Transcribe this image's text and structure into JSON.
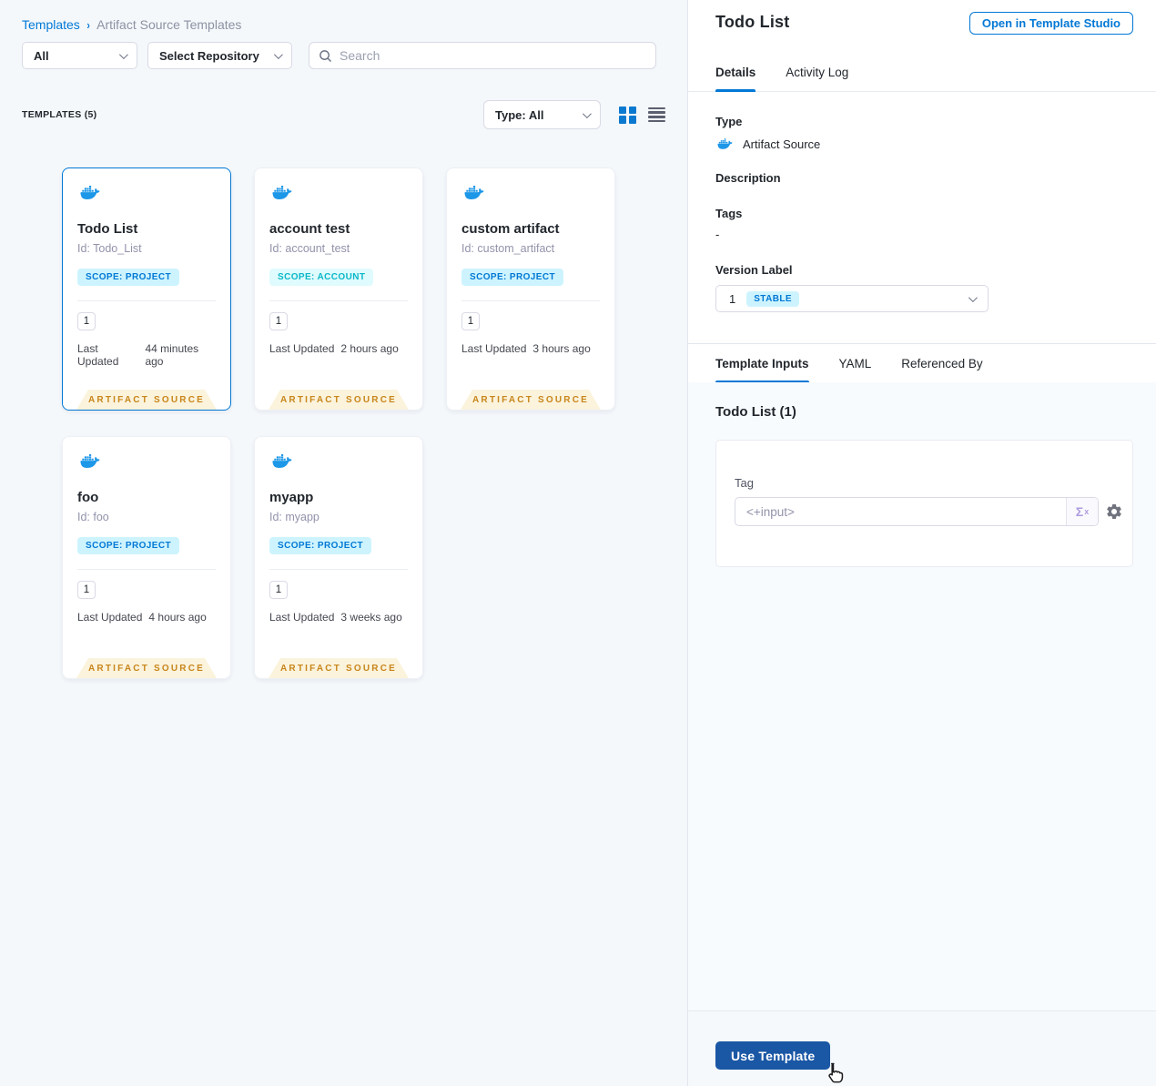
{
  "colors": {
    "primary_blue": "#0278D5",
    "docker_blue": "#1D97E8",
    "use_template_button": "#1A57A5",
    "scope_project_bg": "#CDF4FE",
    "scope_project_text": "#0278D5",
    "scope_account_bg": "#DFFBFD",
    "scope_account_text": "#0AB8C9",
    "ribbon_bg": "#FBF3DC",
    "ribbon_text": "#C8861B",
    "left_panel_bg": "#F4F8FB"
  },
  "icons": {
    "search": "magnifier",
    "grid_view": "2x2-grid",
    "list_view": "4-bars",
    "docker": "docker-whale",
    "gear": "settings-gear",
    "expression": "sigma-x",
    "chevron": "chevron-down",
    "cursor": "hand-pointer"
  },
  "breadcrumb": {
    "templates": "Templates",
    "separator": "›",
    "current": "Artifact Source Templates"
  },
  "filters": {
    "scope_value": "All",
    "repository_value": "Select Repository",
    "search_placeholder": "Search"
  },
  "templates_header": {
    "title": "TEMPLATES (5)",
    "type_filter": "Type: All"
  },
  "cards": [
    {
      "title": "Todo List",
      "id": "Id: Todo_List",
      "scope_label": "SCOPE: PROJECT",
      "version": "1",
      "updated_label": "Last Updated",
      "updated_value": "44 minutes ago",
      "ribbon": "ARTIFACT SOURCE",
      "selected": true
    },
    {
      "title": "account test",
      "id": "Id: account_test",
      "scope_label": "SCOPE: ACCOUNT",
      "version": "1",
      "updated_label": "Last Updated",
      "updated_value": "2 hours ago",
      "ribbon": "ARTIFACT SOURCE",
      "selected": false
    },
    {
      "title": "custom artifact",
      "id": "Id: custom_artifact",
      "scope_label": "SCOPE: PROJECT",
      "version": "1",
      "updated_label": "Last Updated",
      "updated_value": "3 hours ago",
      "ribbon": "ARTIFACT SOURCE",
      "selected": false
    },
    {
      "title": "foo",
      "id": "Id: foo",
      "scope_label": "SCOPE: PROJECT",
      "version": "1",
      "updated_label": "Last Updated",
      "updated_value": "4 hours ago",
      "ribbon": "ARTIFACT SOURCE",
      "selected": false
    },
    {
      "title": "myapp",
      "id": "Id: myapp",
      "scope_label": "SCOPE: PROJECT",
      "version": "1",
      "updated_label": "Last Updated",
      "updated_value": "3 weeks ago",
      "ribbon": "ARTIFACT SOURCE",
      "selected": false
    }
  ],
  "panel": {
    "title": "Todo List",
    "open_button": "Open in Template Studio",
    "tabs": {
      "details": "Details",
      "activity": "Activity Log"
    },
    "details": {
      "type_label": "Type",
      "type_value": "Artifact Source",
      "description_label": "Description",
      "tags_label": "Tags",
      "tags_value": "-",
      "version_label": "Version Label",
      "version_value": "1",
      "version_badge": "STABLE"
    },
    "sub_tabs": {
      "inputs": "Template Inputs",
      "yaml": "YAML",
      "referenced": "Referenced By"
    },
    "inputs_section": {
      "heading": "Todo List (1)",
      "tag_label": "Tag",
      "tag_placeholder": "<+input>",
      "expression_symbol": "Σ",
      "expression_sup": "x"
    },
    "footer": {
      "use_template": "Use Template"
    }
  }
}
